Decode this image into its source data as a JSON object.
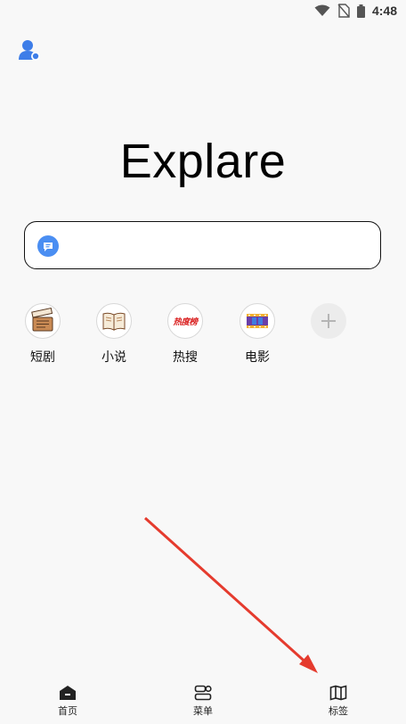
{
  "status_bar": {
    "time": "4:48",
    "icons": [
      "wifi-icon",
      "no-sim-icon",
      "battery-icon"
    ]
  },
  "header": {
    "avatar_icon": "user-avatar-icon"
  },
  "app": {
    "title": "Explare"
  },
  "search": {
    "value": "",
    "placeholder": "",
    "icon": "chat-bubble-icon"
  },
  "shortcuts": [
    {
      "label": "短剧",
      "icon": "clapperboard-icon"
    },
    {
      "label": "小说",
      "icon": "book-icon"
    },
    {
      "label": "热搜",
      "icon": "hot-list-icon",
      "icon_text": "热度榜"
    },
    {
      "label": "电影",
      "icon": "film-strip-icon"
    },
    {
      "label": "",
      "icon": "plus-icon"
    }
  ],
  "bottom_nav": [
    {
      "label": "首页",
      "icon": "home-icon"
    },
    {
      "label": "菜单",
      "icon": "menu-icon"
    },
    {
      "label": "标签",
      "icon": "tabs-map-icon"
    }
  ],
  "colors": {
    "background": "#f8f8f8",
    "accent_blue": "#4a8ef2",
    "arrow_red": "#e53b2e"
  }
}
